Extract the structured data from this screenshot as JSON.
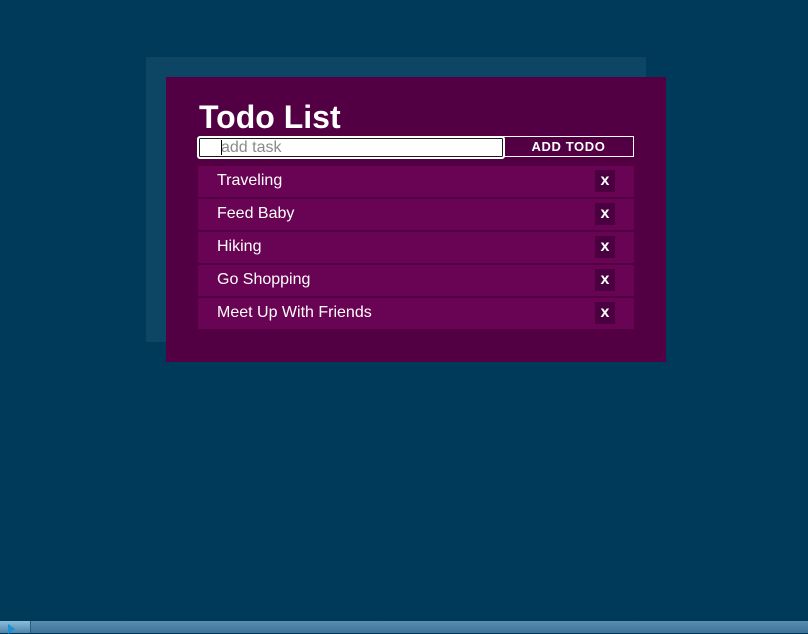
{
  "app": {
    "title": "Todo List"
  },
  "input": {
    "placeholder": "add task",
    "value": ""
  },
  "add_button": {
    "label": "ADD TODO"
  },
  "todos": [
    {
      "label": "Traveling",
      "delete_label": "x"
    },
    {
      "label": "Feed Baby",
      "delete_label": "x"
    },
    {
      "label": "Hiking",
      "delete_label": "x"
    },
    {
      "label": "Go Shopping",
      "delete_label": "x"
    },
    {
      "label": "Meet Up With Friends",
      "delete_label": "x"
    }
  ],
  "colors": {
    "background": "#003a5a",
    "card": "#520043",
    "item": "#690353",
    "delete_button": "#4a0040",
    "text": "#ffffff"
  }
}
